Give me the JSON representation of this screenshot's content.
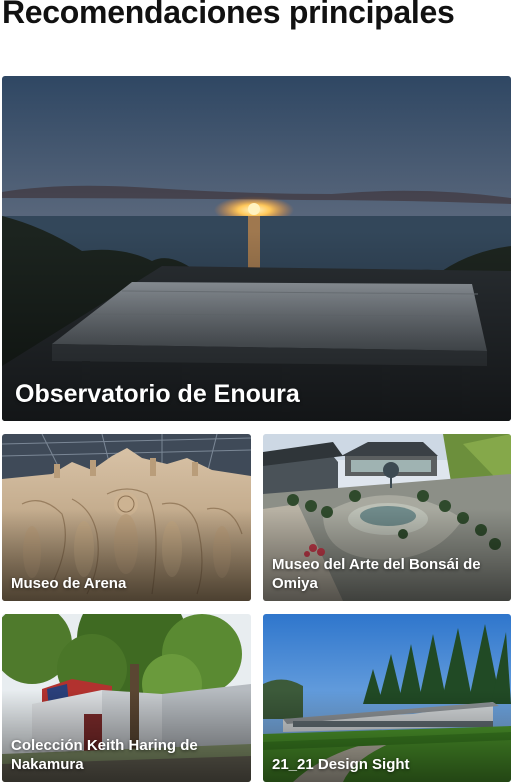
{
  "section": {
    "title": "Recomendaciones principales"
  },
  "cards": [
    {
      "label": "Observatorio de Enoura",
      "scene": "sunset-observatory-image"
    },
    {
      "label": "Museo de Arena",
      "scene": "sand-sculpture-image"
    },
    {
      "label": "Museo del Arte del Bonsái de Omiya",
      "scene": "bonsai-garden-image"
    },
    {
      "label": "Colección Keith Haring de Nakamura",
      "scene": "modern-museum-tree-image"
    },
    {
      "label": "21_21 Design Sight",
      "scene": "design-building-lawn-image"
    }
  ]
}
